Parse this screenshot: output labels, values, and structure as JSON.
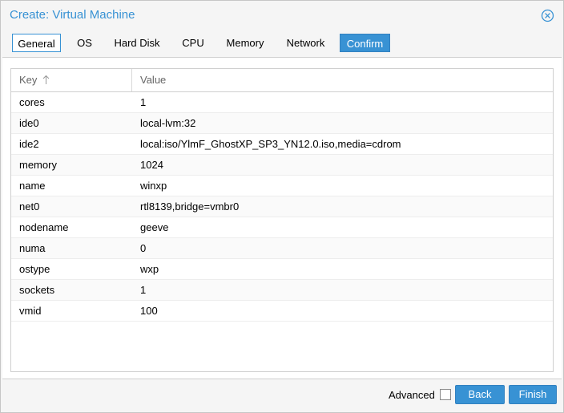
{
  "window": {
    "title": "Create: Virtual Machine"
  },
  "tabs": [
    {
      "label": "General"
    },
    {
      "label": "OS"
    },
    {
      "label": "Hard Disk"
    },
    {
      "label": "CPU"
    },
    {
      "label": "Memory"
    },
    {
      "label": "Network"
    },
    {
      "label": "Confirm"
    }
  ],
  "grid": {
    "columns": {
      "key": "Key",
      "value": "Value"
    },
    "sort": "ascending",
    "rows": [
      {
        "key": "cores",
        "value": "1"
      },
      {
        "key": "ide0",
        "value": "local-lvm:32"
      },
      {
        "key": "ide2",
        "value": "local:iso/YlmF_GhostXP_SP3_YN12.0.iso,media=cdrom"
      },
      {
        "key": "memory",
        "value": "1024"
      },
      {
        "key": "name",
        "value": "winxp"
      },
      {
        "key": "net0",
        "value": "rtl8139,bridge=vmbr0"
      },
      {
        "key": "nodename",
        "value": "geeve"
      },
      {
        "key": "numa",
        "value": "0"
      },
      {
        "key": "ostype",
        "value": "wxp"
      },
      {
        "key": "sockets",
        "value": "1"
      },
      {
        "key": "vmid",
        "value": "100"
      }
    ]
  },
  "footer": {
    "advanced_label": "Advanced",
    "advanced_checked": false,
    "back_label": "Back",
    "finish_label": "Finish"
  },
  "colors": {
    "accent": "#3892d4"
  },
  "icons": {
    "close": "close-circle-icon",
    "sort": "arrow-up-icon"
  }
}
